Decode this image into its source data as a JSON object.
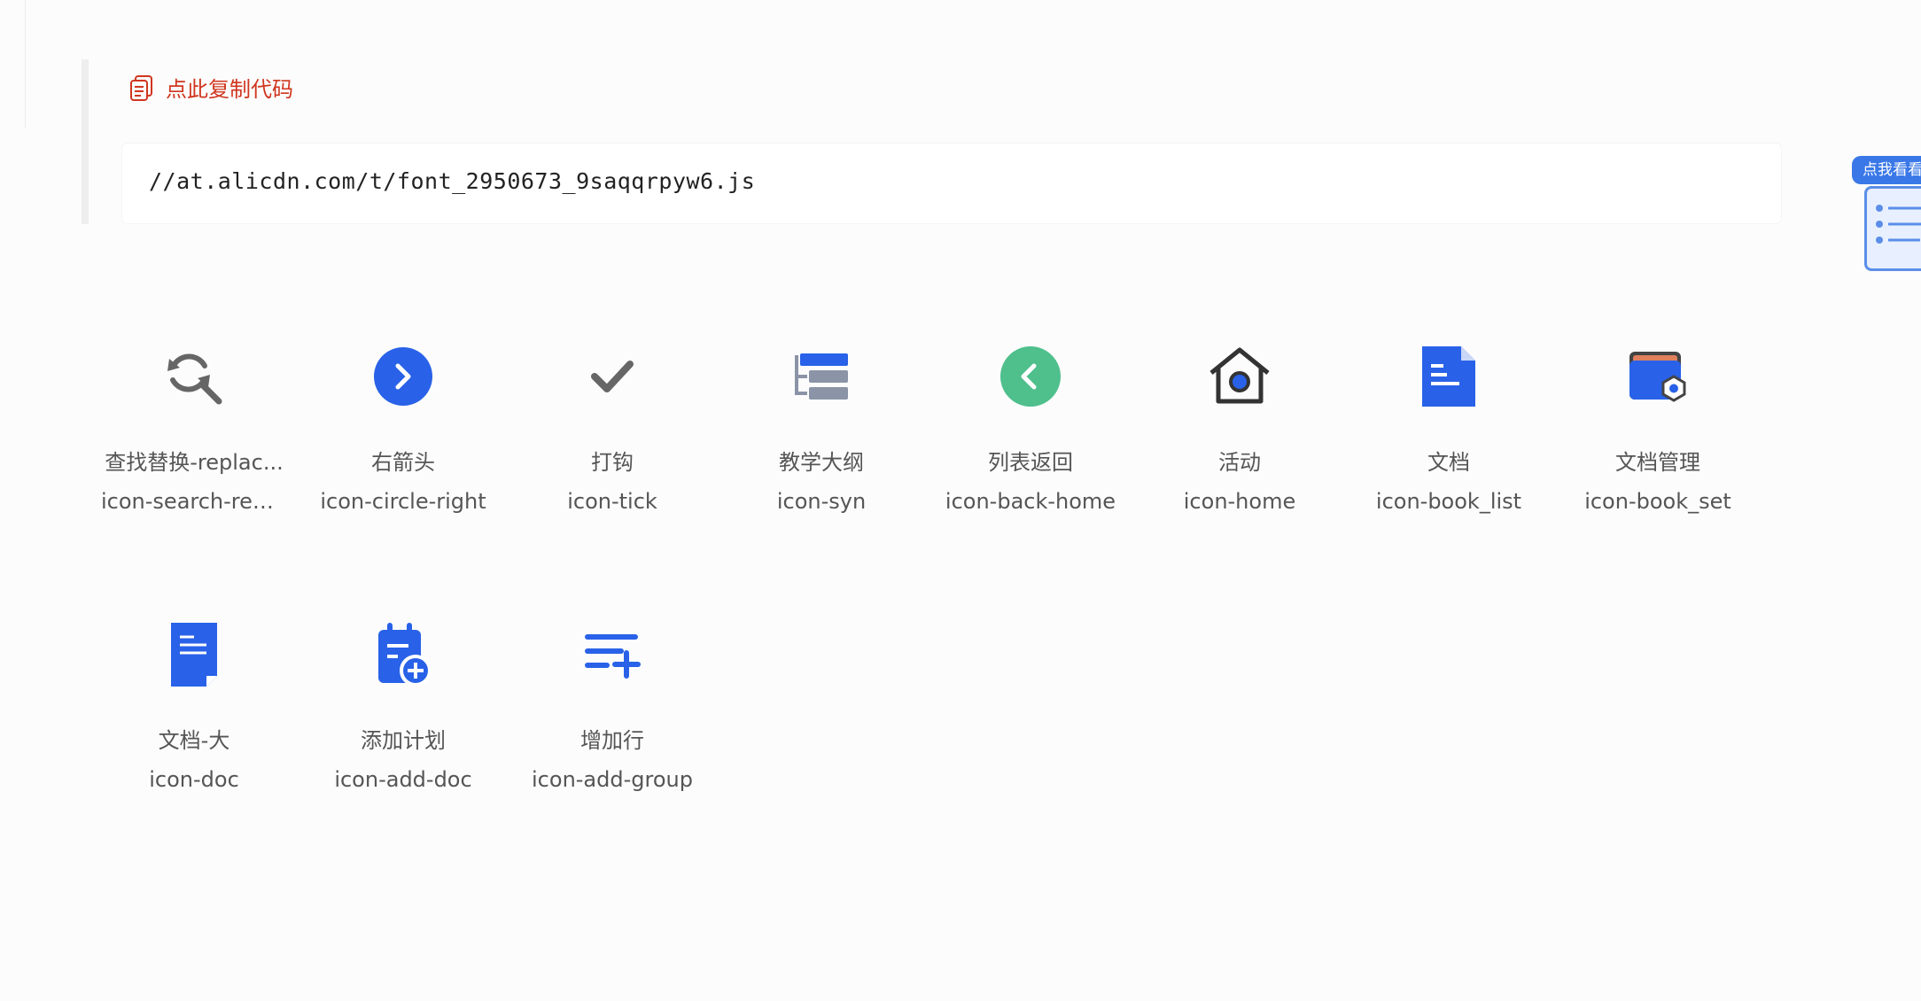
{
  "copy_link": {
    "label": "点此复制代码"
  },
  "code": {
    "text": "//at.alicdn.com/t/font_2950673_9saqqrpyw6.js"
  },
  "icons": [
    {
      "name": "查找替换-replac...",
      "code": "icon-search-repl..."
    },
    {
      "name": "右箭头",
      "code": "icon-circle-right"
    },
    {
      "name": "打钩",
      "code": "icon-tick"
    },
    {
      "name": "教学大纲",
      "code": "icon-syn"
    },
    {
      "name": "列表返回",
      "code": "icon-back-home"
    },
    {
      "name": "活动",
      "code": "icon-home"
    },
    {
      "name": "文档",
      "code": "icon-book_list"
    },
    {
      "name": "文档管理",
      "code": "icon-book_set"
    },
    {
      "name": "文档-大",
      "code": "icon-doc"
    },
    {
      "name": "添加计划",
      "code": "icon-add-doc"
    },
    {
      "name": "增加行",
      "code": "icon-add-group"
    }
  ],
  "float_widget": {
    "label": "点我看看"
  },
  "colors": {
    "accent_red": "#d0361f",
    "icon_blue": "#2962e8",
    "icon_green": "#4fbf8c",
    "icon_gray": "#666666"
  }
}
